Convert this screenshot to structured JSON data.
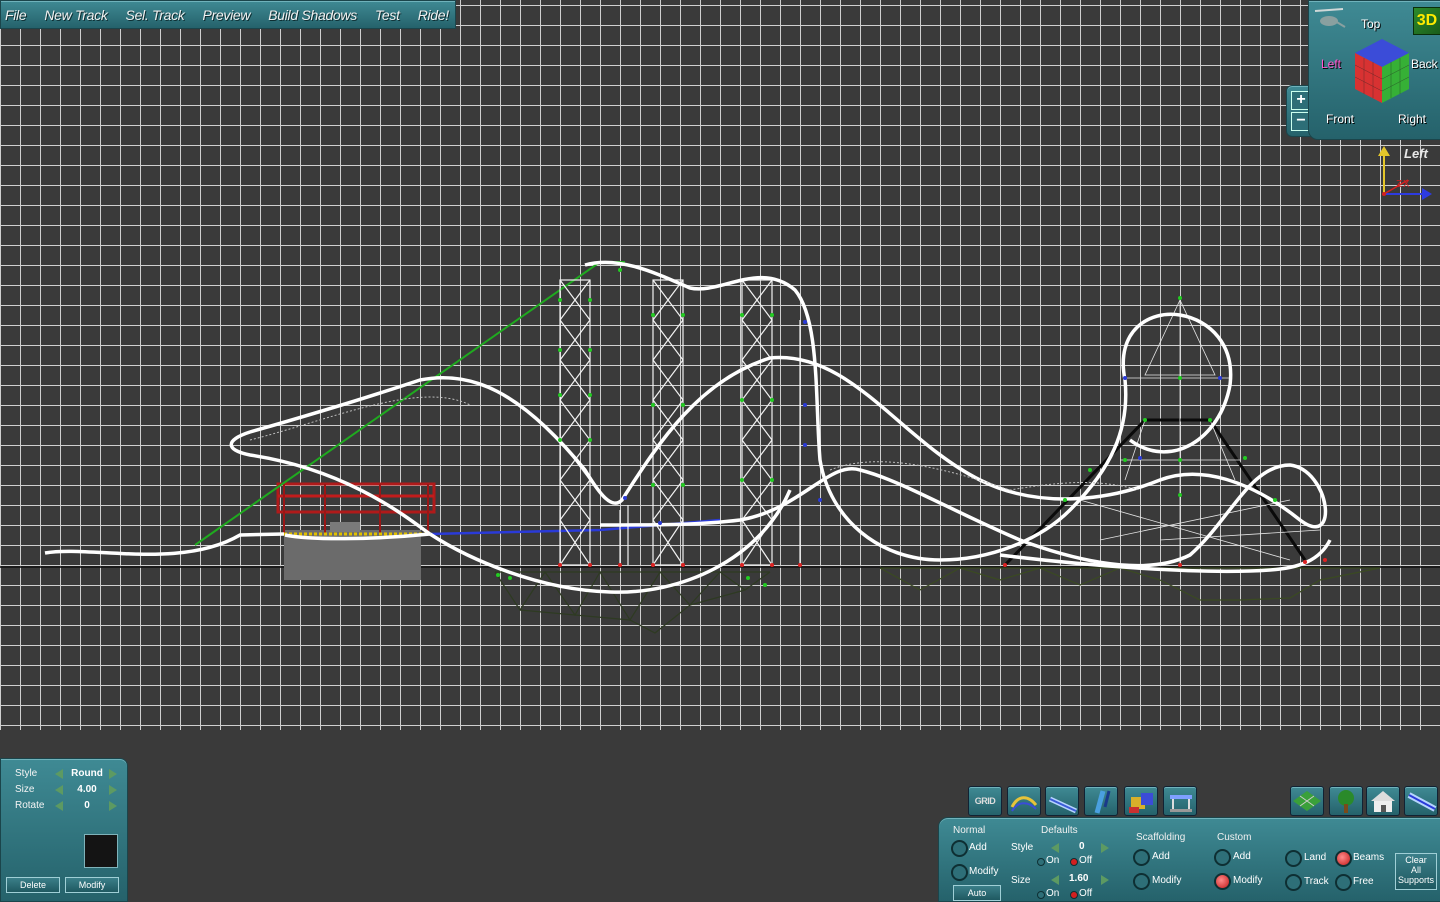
{
  "menu": {
    "items": [
      "File",
      "New Track",
      "Sel. Track",
      "Preview",
      "Build Shadows",
      "Test",
      "Ride!"
    ]
  },
  "view_cube": {
    "title": "3D",
    "top": "Top",
    "left": "Left",
    "back": "Back",
    "front": "Front",
    "right": "Right",
    "zoom_in": "+",
    "zoom_out": "−"
  },
  "axis_indicator": {
    "label": "Left",
    "z": "Z",
    "x": "X"
  },
  "properties": {
    "style_label": "Style",
    "style_value": "Round",
    "size_label": "Size",
    "size_value": "4.00",
    "rotate_label": "Rotate",
    "rotate_value": "0",
    "delete": "Delete",
    "modify": "Modify"
  },
  "toolbar": {
    "grid": "GRID",
    "icons": [
      "grid-icon",
      "track-icon",
      "rail-icon",
      "pipe-icon",
      "block-icon",
      "station-icon",
      "terrain-icon",
      "tree-icon",
      "house-icon",
      "rail-right-icon"
    ]
  },
  "supports": {
    "normal": {
      "title": "Normal",
      "add": "Add",
      "modify": "Modify",
      "auto": "Auto"
    },
    "defaults": {
      "title": "Defaults",
      "style_label": "Style",
      "style_value": "0",
      "on": "On",
      "off": "Off",
      "size_label": "Size",
      "size_value": "1.60"
    },
    "scaffolding": {
      "title": "Scaffolding",
      "add": "Add",
      "modify": "Modify"
    },
    "custom": {
      "title": "Custom",
      "add": "Add",
      "modify": "Modify",
      "land": "Land",
      "beams": "Beams",
      "track": "Track",
      "free": "Free"
    },
    "clear": {
      "line1": "Clear",
      "line2": "All",
      "line3": "Supports"
    }
  },
  "colors": {
    "panel": "#2d727c",
    "track": "#ffffff",
    "lift_chain": "#1faa1f",
    "brake": "#2a3ad8",
    "station_roof": "#b01a1a",
    "support": "#ffffff",
    "node": "#22cc22"
  }
}
